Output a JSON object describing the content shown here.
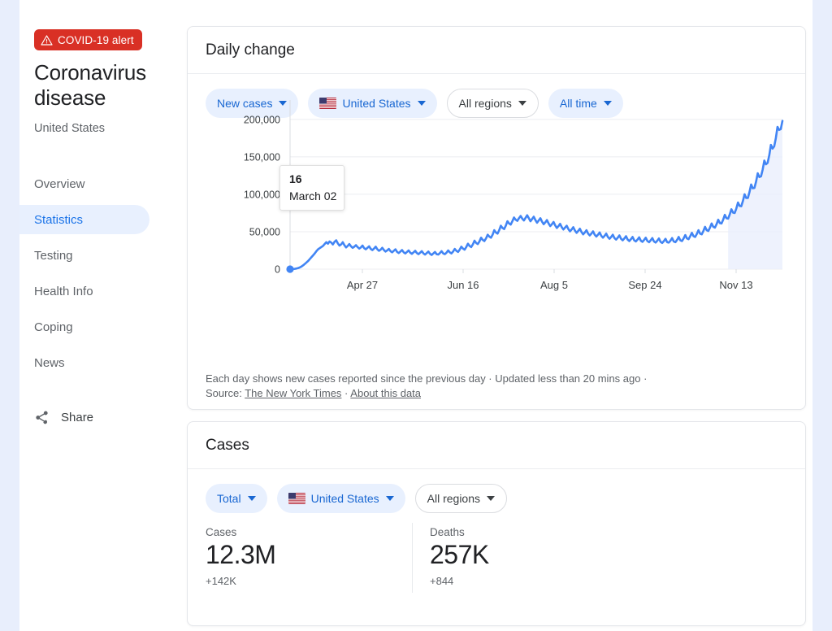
{
  "sidebar": {
    "alert": {
      "label": "COVID-19 alert",
      "icon": "warning-triangle-icon",
      "color": "#d93025"
    },
    "title": "Coronavirus disease",
    "subtitle": "United States",
    "items": [
      {
        "label": "Overview",
        "active": false
      },
      {
        "label": "Statistics",
        "active": true
      },
      {
        "label": "Testing",
        "active": false
      },
      {
        "label": "Health Info",
        "active": false
      },
      {
        "label": "Coping",
        "active": false
      },
      {
        "label": "News",
        "active": false
      }
    ],
    "share": {
      "label": "Share",
      "icon": "share-icon"
    }
  },
  "daily_card": {
    "title": "Daily change",
    "chips": [
      {
        "label": "New cases",
        "style": "filled",
        "flag": false
      },
      {
        "label": "United States",
        "style": "filled",
        "flag": true
      },
      {
        "label": "All regions",
        "style": "outline",
        "flag": false
      },
      {
        "label": "All time",
        "style": "filled",
        "flag": false
      }
    ],
    "tooltip": {
      "value": "16",
      "date": "March 02"
    },
    "footnote": {
      "text": "Each day shows new cases reported since the previous day · Updated less than 20 mins ago ·",
      "source_prefix": "Source:",
      "source_link": "The New York Times",
      "separator": "·",
      "about_link": "About this data"
    }
  },
  "cases_card": {
    "title": "Cases",
    "chips": [
      {
        "label": "Total",
        "style": "filled",
        "flag": false
      },
      {
        "label": "United States",
        "style": "filled",
        "flag": true
      },
      {
        "label": "All regions",
        "style": "outline",
        "flag": false
      }
    ],
    "stats": [
      {
        "label": "Cases",
        "value": "12.3M",
        "delta": "+142K"
      },
      {
        "label": "Deaths",
        "value": "257K",
        "delta": "+844"
      }
    ]
  },
  "colors": {
    "accent": "#1a73e8",
    "line": "#4285f4",
    "chip_fill": "#e8f0fe",
    "alert_red": "#d93025",
    "text_primary": "#202124",
    "text_secondary": "#5f6368"
  },
  "chart_data": {
    "type": "line",
    "title": "Daily change",
    "xlabel": "",
    "ylabel": "",
    "grid": true,
    "legend": false,
    "ylim": [
      0,
      215000
    ],
    "yticks": [
      0,
      50000,
      100000,
      150000,
      200000
    ],
    "ytick_labels": [
      "0",
      "50,000",
      "100,000",
      "150,000",
      "200,000"
    ],
    "xtick_labels": [
      "Apr 27",
      "Jun 16",
      "Aug 5",
      "Sep 24",
      "Nov 13"
    ],
    "x_start": "March 02",
    "x_end": "Nov 18",
    "series": [
      {
        "name": "New cases",
        "color": "#4285f4",
        "values": [
          16,
          60,
          200,
          500,
          900,
          1500,
          2400,
          3600,
          5200,
          7000,
          9000,
          11000,
          13500,
          16000,
          18500,
          21000,
          24000,
          26500,
          28000,
          29500,
          31000,
          33500,
          36000,
          34000,
          37000,
          35500,
          33000,
          36500,
          38500,
          34500,
          31500,
          33000,
          36000,
          32000,
          29000,
          31000,
          33500,
          30500,
          28500,
          30000,
          32000,
          29500,
          27500,
          29000,
          31500,
          28000,
          26500,
          28500,
          30500,
          27000,
          25500,
          27500,
          30000,
          26500,
          24500,
          26000,
          28500,
          25500,
          23500,
          25000,
          27000,
          24000,
          22500,
          24500,
          26500,
          23000,
          21500,
          23500,
          25500,
          22500,
          21000,
          23000,
          25000,
          22000,
          20500,
          22500,
          24500,
          21500,
          20000,
          22000,
          24000,
          21000,
          19500,
          21500,
          23500,
          20500,
          19000,
          21000,
          23000,
          20000,
          19500,
          21500,
          24000,
          21000,
          20000,
          22000,
          25000,
          22500,
          21000,
          23500,
          27000,
          24500,
          23000,
          26000,
          30000,
          27500,
          26000,
          29500,
          34000,
          31000,
          29500,
          33000,
          38000,
          35000,
          33500,
          37000,
          42000,
          39000,
          37500,
          41000,
          46000,
          43500,
          42000,
          46000,
          52000,
          49000,
          47500,
          52000,
          58000,
          55000,
          53500,
          58000,
          64000,
          61000,
          59500,
          64000,
          69000,
          66000,
          64500,
          68000,
          71000,
          67500,
          65000,
          68500,
          72000,
          68000,
          64000,
          67000,
          70000,
          65500,
          62000,
          65000,
          68000,
          63500,
          60000,
          62500,
          65500,
          61000,
          57500,
          60000,
          63000,
          58500,
          55000,
          57500,
          60500,
          56000,
          53000,
          55500,
          58000,
          53500,
          50500,
          53000,
          56000,
          51500,
          48500,
          51000,
          54000,
          49500,
          46500,
          49000,
          52000,
          47500,
          45000,
          47500,
          50500,
          46000,
          43500,
          46000,
          49000,
          44500,
          42000,
          44500,
          47500,
          43000,
          40500,
          43000,
          46000,
          41500,
          39500,
          42000,
          45000,
          40500,
          38500,
          41000,
          44000,
          39500,
          37500,
          40000,
          43000,
          38500,
          37000,
          39500,
          42500,
          38000,
          36500,
          39000,
          42000,
          37500,
          36000,
          38500,
          41500,
          37000,
          35500,
          38000,
          41000,
          36500,
          35000,
          37500,
          40500,
          36000,
          35500,
          38000,
          41500,
          37000,
          36000,
          39000,
          43000,
          38500,
          37500,
          41000,
          45500,
          41000,
          40000,
          44000,
          48500,
          44000,
          43000,
          47000,
          52000,
          47500,
          46500,
          51000,
          56500,
          52000,
          51000,
          55500,
          61000,
          56500,
          55500,
          60000,
          66000,
          61500,
          61000,
          66000,
          72500,
          68000,
          67500,
          73000,
          80000,
          75500,
          75000,
          81000,
          89000,
          84500,
          84000,
          91000,
          100000,
          95000,
          95000,
          103000,
          113000,
          108000,
          108500,
          117000,
          128000,
          123000,
          124000,
          133000,
          145000,
          140000,
          142000,
          152000,
          166000,
          161000,
          164000,
          175000,
          190000,
          186000,
          187000,
          198000
        ]
      }
    ],
    "tooltip_point": {
      "x": "March 02",
      "y": 16
    }
  }
}
